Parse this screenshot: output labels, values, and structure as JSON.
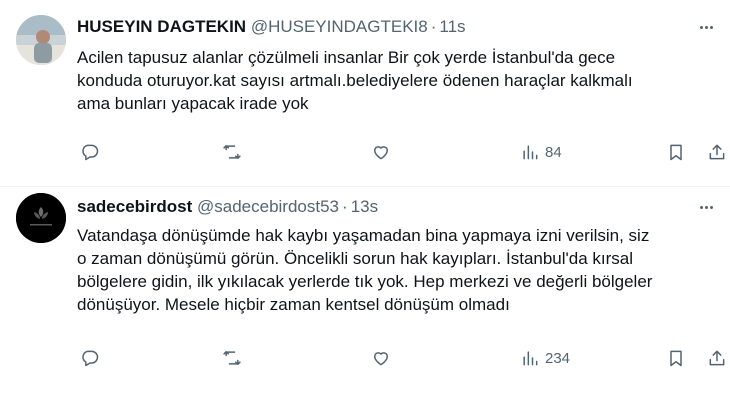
{
  "tweets": [
    {
      "name": "HUSEYIN DAGTEKIN",
      "handle": "@HUSEYINDAGTEKI8",
      "separator": "·",
      "time": "11s",
      "text_lines": [
        "Acilen tapusuz alanlar çözülmeli insanlar Bir çok yerde İstanbul'da gece",
        "konduda oturuyor.kat sayısı artmalı.belediyelere ödenen haraçlar kalkmalı",
        "ama bunları yapacak irade yok"
      ],
      "views": "84"
    },
    {
      "name": "sadecebirdost",
      "handle": "@sadecebirdost53",
      "separator": "·",
      "time": "13s",
      "text_lines": [
        "Vatandaşa dönüşümde hak kaybı yaşamadan bina yapmaya izni verilsin, siz",
        "o zaman dönüşümü görün. Öncelikli sorun hak kayıpları. İstanbul'da kırsal",
        "bölgelere gidin, ilk yıkılacak yerlerde tık yok. Hep merkezi ve değerli bölgeler",
        "dönüşüyor. Mesele hiçbir zaman kentsel dönüşüm olmadı"
      ],
      "views": "234"
    }
  ],
  "icons": {
    "reply": "reply-icon",
    "retweet": "retweet-icon",
    "like": "heart-icon",
    "views": "views-icon",
    "bookmark": "bookmark-icon",
    "share": "share-icon",
    "more": "more-options-icon"
  },
  "colors": {
    "text": "#0f1419",
    "secondary": "#536471",
    "divider": "#eff3f4"
  }
}
